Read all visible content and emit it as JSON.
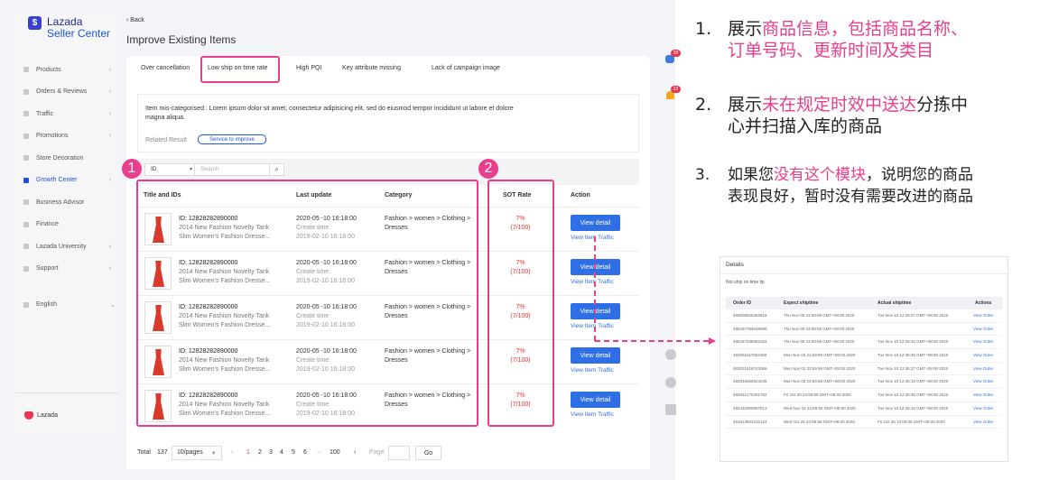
{
  "brand": {
    "name": "Lazada",
    "sub": "Seller Center"
  },
  "sidebar": {
    "items": [
      {
        "label": "Products",
        "chev": "›"
      },
      {
        "label": "Orders & Reviews",
        "chev": "›"
      },
      {
        "label": "Traffic",
        "chev": "›"
      },
      {
        "label": "Promotions",
        "chev": "›"
      },
      {
        "label": "Store Decoration",
        "chev": ""
      },
      {
        "label": "Growth Center",
        "chev": "›"
      },
      {
        "label": "Business Advisor",
        "chev": ""
      },
      {
        "label": "Finance",
        "chev": ""
      },
      {
        "label": "Lazada University",
        "chev": "›"
      },
      {
        "label": "Support",
        "chev": "›"
      }
    ],
    "language": "English",
    "language_chev": "⌄",
    "footer_logo": "Lazada"
  },
  "header": {
    "back": "‹  Back",
    "title": "Improve Existing Items"
  },
  "tabs": [
    {
      "label": "Over cancellation"
    },
    {
      "label": "Low ship on time rate"
    },
    {
      "label": "High PQI"
    },
    {
      "label": "Key attribute missing"
    },
    {
      "label": "Lack of campaign image"
    }
  ],
  "notice": {
    "text": "Item mis-categorised : Lorem ipsum dolor sit amet, consectetur adipisicing elit, sed do eiusmod tempor incididunt ut labore et dolore magna aliqua.",
    "related_label": "Related Result",
    "service_button": "Service to improve"
  },
  "filter": {
    "select_value": "ID",
    "select_arrow": "▾",
    "search_placeholder": "Search",
    "search_icon": "⌕"
  },
  "table": {
    "headers": {
      "title": "Title and IDs",
      "update": "Last update",
      "category": "Category",
      "sot": "SOT Rate",
      "action": "Action"
    },
    "rows": [
      {
        "id": "ID: 12828282890000",
        "name1": "2014 New Fashion Novelty Tank",
        "name2": "Slim Women's Fashion Dresse...",
        "updated": "2020-05 -10  16:18:00",
        "create_label": "Create time:",
        "created": "2019-02-10  16:18:00",
        "category": "Fashion > women > Clothing > Dresses",
        "sot": "7%",
        "sot_detail": "(7/100)",
        "action": "View detail",
        "traffic": "View Item Traffic"
      },
      {
        "id": "ID: 12828282890000",
        "name1": "2014 New Fashion Novelty Tank",
        "name2": "Slim Women's Fashion Dresse...",
        "updated": "2020-05 -10  16:18:00",
        "create_label": "Create time:",
        "created": "2019-02-10  16:18:00",
        "category": "Fashion > women > Clothing > Dresses",
        "sot": "7%",
        "sot_detail": "(7/100)",
        "action": "View detail",
        "traffic": "View Item Traffic"
      },
      {
        "id": "ID: 12828282890000",
        "name1": "2014 New Fashion Novelty Tank",
        "name2": "Slim Women's Fashion Dresse...",
        "updated": "2020-05 -10  16:18:00",
        "create_label": "Create time:",
        "created": "2019-02-10  16:18:00",
        "category": "Fashion > women > Clothing > Dresses",
        "sot": "7%",
        "sot_detail": "(7/100)",
        "action": "View detail",
        "traffic": "View Item Traffic"
      },
      {
        "id": "ID: 12828282890000",
        "name1": "2014 New Fashion Novelty Tank",
        "name2": "Slim Women's Fashion Dresse...",
        "updated": "2020-05 -10  16:18:00",
        "create_label": "Create time:",
        "created": "2019-02-10  16:18:00",
        "category": "Fashion > women > Clothing > Dresses",
        "sot": "7%",
        "sot_detail": "(7/100)",
        "action": "View detail",
        "traffic": "View Item Traffic"
      },
      {
        "id": "ID: 12828282890000",
        "name1": "2014 New Fashion Novelty Tank",
        "name2": "Slim Women's Fashion Dresse...",
        "updated": "2020-05 -10  16:18:00",
        "create_label": "Create time:",
        "created": "2019-02-10  16:18:00",
        "category": "Fashion > women > Clothing > Dresses",
        "sot": "7%",
        "sot_detail": "(7/100)",
        "action": "View detail",
        "traffic": "View Item Traffic"
      }
    ]
  },
  "pagination": {
    "total_label": "Total",
    "total": "137",
    "per_page": "10/pages",
    "per_page_arrow": "▾",
    "prev": "‹",
    "pages": [
      "1",
      "2",
      "3",
      "4",
      "5",
      "6",
      "···",
      "100"
    ],
    "next": "›",
    "page_label": "Page",
    "go": "Go"
  },
  "callouts": {
    "one": "1",
    "two": "2"
  },
  "notifications": {
    "a": "30",
    "b": "22"
  },
  "annotations": [
    {
      "num": "1.",
      "pre": "展示",
      "pink": "商品信息，包括商品名称、",
      "line2_pink": "订单号码、更新时间及类目",
      "post": ""
    },
    {
      "num": "2.",
      "pre": "展示",
      "pink": "未在规定时效中送达",
      "post": "分拣中",
      "line2": "心并扫描入库的商品"
    },
    {
      "num": "3.",
      "pre": "如果您",
      "pink": "没有这个模块",
      "post": "，说明您的商品",
      "line2": "表现良好，暂时没有需要改进的商品"
    }
  ],
  "details": {
    "title": "Details",
    "subtitle": "Not ship on time tip",
    "headers": {
      "order": "Order ID",
      "expect": "Expect shiptime",
      "actual": "Actual shiptime",
      "actions": "Actions"
    },
    "rows": [
      {
        "order": "486609526453618",
        "expect": "Thu Nov 05 23:59:59 GMT+08:00 2020",
        "actual": "Tue Nov 10 12:28:37 GMT+08:00 2020",
        "action": "View Order"
      },
      {
        "order": "485437766045680",
        "expect": "Thu Nov 05 23:59:59 GMT+08:00 2020",
        "actual": "",
        "action": "View Order"
      },
      {
        "order": "485437538083262",
        "expect": "Thu Nov 05 23:59:59 GMT+08:00 2020",
        "actual": "Tue Nov 10 12:26:34 GMT+08:00 2020",
        "action": "View Order"
      },
      {
        "order": "483091157853480",
        "expect": "Mon Nov 02 23:59:59 GMT+08:00 2020",
        "actual": "Tue Nov 10 12:36:36 GMT+08:00 2020",
        "action": "View Order"
      },
      {
        "order": "483021518743066",
        "expect": "Mon Nov 02 23:59:59 GMT+08:00 2020",
        "actual": "Tue Nov 10 12:36:37 GMT+08:00 2020",
        "action": "View Order"
      },
      {
        "order": "482815566924248",
        "expect": "Mon Nov 02 23:59:59 GMT+08:00 2020",
        "actual": "Tue Nov 10 12:35:18 GMT+08:00 2020",
        "action": "View Order"
      },
      {
        "order": "482642179391782",
        "expect": "Fri Oct 30 23:59:59 GMT+08:00 2020",
        "actual": "Tue Nov 10 12:35:35 GMT+08:00 2020",
        "action": "View Order"
      },
      {
        "order": "482432909587913",
        "expect": "Wed Nov 04 23:59:59 GMT+08:00 2020",
        "actual": "Tue Nov 10 12:26:16 GMT+08:00 2020",
        "action": "View Order"
      },
      {
        "order": "481613504232124",
        "expect": "Wed Oct 28 23:59:59 GMT+08:00 2020",
        "actual": "Fri Oct 30 13:00:06 GMT+08:00 2020",
        "action": "View Order"
      }
    ]
  },
  "colors": {
    "accent": "#2f6fe6",
    "highlight": "#e83e8c",
    "brand": "#1a56d6",
    "sot_red": "#e0302b"
  }
}
